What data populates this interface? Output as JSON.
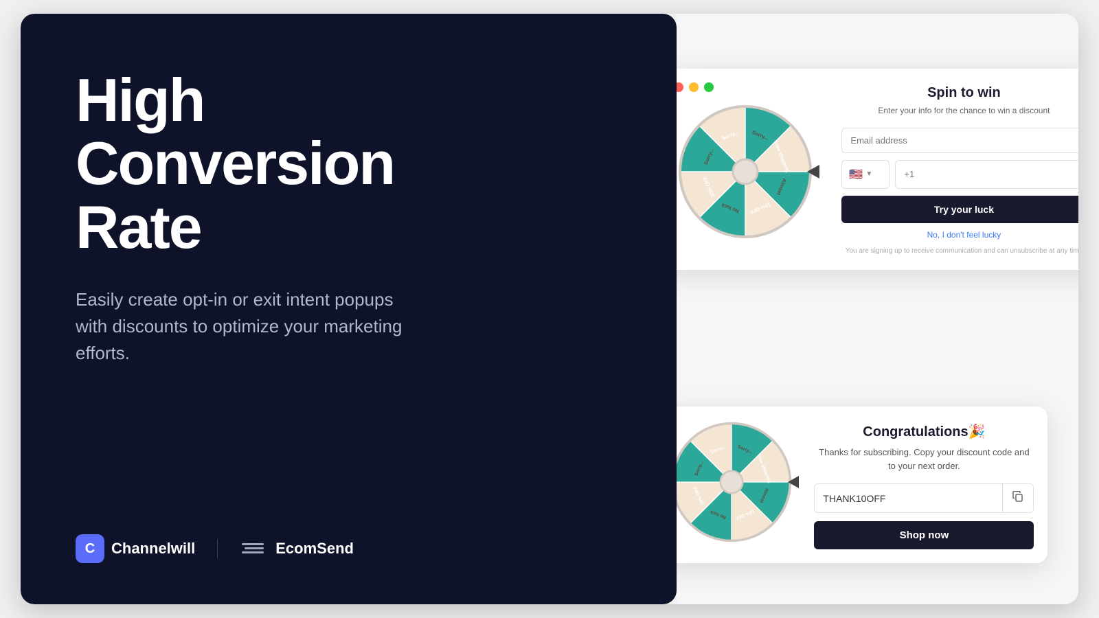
{
  "left": {
    "title_line1": "High",
    "title_line2": "Conversion",
    "title_line3": "Rate",
    "subtitle": "Easily create opt-in or exit intent popups with discounts to optimize your marketing efforts.",
    "brand1_name": "Channelwill",
    "brand1_letter": "C",
    "brand2_name": "EcomSend"
  },
  "popup_spin": {
    "title": "Spin to win",
    "subtitle": "Enter your info for the chance to win a discount",
    "email_placeholder": "Email address",
    "phone_placeholder": "+1",
    "phone_flag": "🇺🇸",
    "cta_label": "Try your luck",
    "no_lucky_label": "No, I don't feel lucky",
    "disclaimer": "You are signing up to receive communication and can unsubscribe at any time"
  },
  "popup_congrats": {
    "title": "Congratulations🎉",
    "text": "Thanks for subscribing. Copy your discount code and to your next order.",
    "discount_code": "THANK10OFF",
    "shop_now_label": "Shop now"
  },
  "wheel": {
    "segments": [
      {
        "label": "Free shipping",
        "type": "teal"
      },
      {
        "label": "Almost",
        "type": "cream"
      },
      {
        "label": "10% OFF",
        "type": "teal"
      },
      {
        "label": "No luck",
        "type": "cream"
      },
      {
        "label": "15% OFF",
        "type": "teal"
      },
      {
        "label": "Sorry...",
        "type": "cream"
      },
      {
        "label": "Sorry...",
        "type": "teal"
      },
      {
        "label": "Sorry...",
        "type": "cream"
      }
    ]
  },
  "close_icon": "×"
}
